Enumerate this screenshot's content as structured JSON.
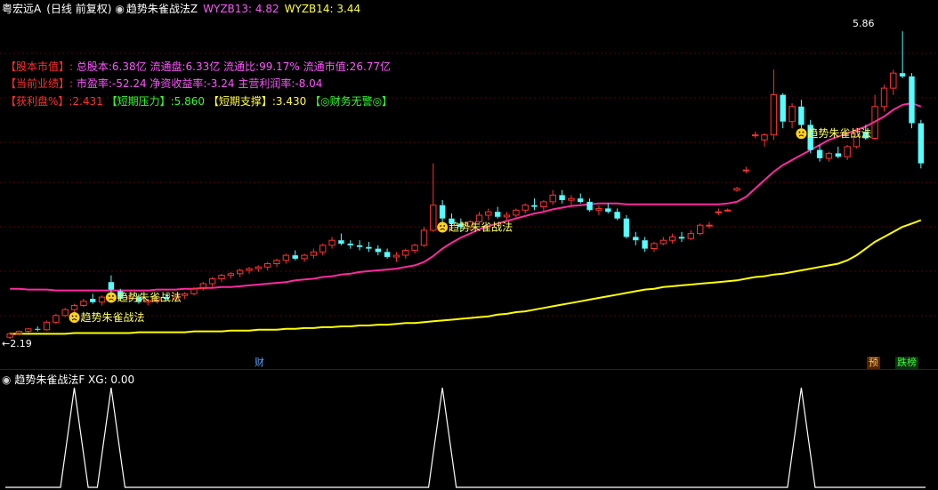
{
  "header": {
    "stock_name": "粤宏远A",
    "period": "(日线 前复权)",
    "indicator_name": "趋势朱雀战法Z",
    "ind1_label": "WYZB13: 4.82",
    "ind2_label": "WYZB14: 3.44"
  },
  "info": {
    "line1_tag": "【股本市值】:",
    "line1_text": "总股本:6.38亿 流通盘:6.33亿 流通比:99.17% 流通市值:26.77亿",
    "line2_tag": "【当前业绩】:",
    "line2_text": "市盈率:-52.24 净资收益率:-3.24 主营利润率:-8.04",
    "line3_a": "【获利盘%】:2.431",
    "line3_b": "【短期压力】:5.860",
    "line3_c": "【短期支撑】:3.430",
    "line3_d": "【◎财务无警◎】"
  },
  "annotations": {
    "signal_label": "趋势朱雀战法",
    "high_label": "5.86",
    "low_label": "2.19",
    "cai_badge": "财",
    "yu_badge": "预",
    "diebang_badge": "跌榜"
  },
  "sub_panel": {
    "title": "趋势朱雀战法F",
    "xg_label": "XG: 0.00"
  },
  "colors": {
    "up": "#ff3232",
    "down": "#54ffff",
    "ma_pink": "#ff2aa0",
    "ma_yellow": "#ffff00",
    "signal_text": "#ffff66"
  },
  "chart_data": {
    "type": "candlestick",
    "title": "粤宏远A (日线 前复权)",
    "ylim": [
      2.0,
      6.0
    ],
    "ohlc": [
      [
        2.2,
        2.26,
        2.18,
        2.24
      ],
      [
        2.24,
        2.28,
        2.22,
        2.27
      ],
      [
        2.27,
        2.31,
        2.25,
        2.3
      ],
      [
        2.3,
        2.33,
        2.27,
        2.29
      ],
      [
        2.29,
        2.4,
        2.28,
        2.38
      ],
      [
        2.38,
        2.48,
        2.36,
        2.46
      ],
      [
        2.46,
        2.55,
        2.44,
        2.53
      ],
      [
        2.53,
        2.6,
        2.5,
        2.58
      ],
      [
        2.58,
        2.66,
        2.56,
        2.63
      ],
      [
        2.66,
        2.72,
        2.6,
        2.62
      ],
      [
        2.62,
        2.7,
        2.58,
        2.68
      ],
      [
        2.86,
        2.94,
        2.74,
        2.77
      ],
      [
        2.75,
        2.78,
        2.65,
        2.66
      ],
      [
        2.66,
        2.7,
        2.62,
        2.68
      ],
      [
        2.68,
        2.72,
        2.6,
        2.62
      ],
      [
        2.62,
        2.66,
        2.58,
        2.64
      ],
      [
        2.64,
        2.7,
        2.6,
        2.68
      ],
      [
        2.68,
        2.72,
        2.64,
        2.66
      ],
      [
        2.66,
        2.72,
        2.62,
        2.7
      ],
      [
        2.7,
        2.74,
        2.66,
        2.72
      ],
      [
        2.72,
        2.8,
        2.7,
        2.78
      ],
      [
        2.78,
        2.86,
        2.76,
        2.84
      ],
      [
        2.84,
        2.92,
        2.8,
        2.9
      ],
      [
        2.9,
        2.96,
        2.86,
        2.94
      ],
      [
        2.94,
        2.98,
        2.9,
        2.96
      ],
      [
        2.96,
        3.02,
        2.92,
        3.0
      ],
      [
        3.0,
        3.04,
        2.96,
        3.02
      ],
      [
        3.02,
        3.06,
        2.98,
        3.04
      ],
      [
        3.04,
        3.1,
        3.0,
        3.08
      ],
      [
        3.08,
        3.14,
        3.04,
        3.12
      ],
      [
        3.12,
        3.2,
        3.08,
        3.18
      ],
      [
        3.18,
        3.24,
        3.12,
        3.14
      ],
      [
        3.14,
        3.2,
        3.1,
        3.18
      ],
      [
        3.18,
        3.26,
        3.14,
        3.22
      ],
      [
        3.22,
        3.32,
        3.18,
        3.3
      ],
      [
        3.3,
        3.4,
        3.26,
        3.36
      ],
      [
        3.36,
        3.44,
        3.3,
        3.32
      ],
      [
        3.32,
        3.36,
        3.26,
        3.3
      ],
      [
        3.3,
        3.36,
        3.24,
        3.28
      ],
      [
        3.28,
        3.34,
        3.22,
        3.26
      ],
      [
        3.26,
        3.3,
        3.18,
        3.22
      ],
      [
        3.22,
        3.26,
        3.14,
        3.16
      ],
      [
        3.16,
        3.22,
        3.1,
        3.18
      ],
      [
        3.18,
        3.26,
        3.14,
        3.24
      ],
      [
        3.24,
        3.32,
        3.2,
        3.3
      ],
      [
        3.3,
        3.52,
        3.28,
        3.48
      ],
      [
        3.48,
        4.28,
        3.46,
        3.78
      ],
      [
        3.78,
        3.84,
        3.58,
        3.62
      ],
      [
        3.62,
        3.68,
        3.5,
        3.56
      ],
      [
        3.56,
        3.62,
        3.46,
        3.52
      ],
      [
        3.52,
        3.6,
        3.48,
        3.58
      ],
      [
        3.58,
        3.7,
        3.54,
        3.66
      ],
      [
        3.66,
        3.74,
        3.6,
        3.7
      ],
      [
        3.7,
        3.76,
        3.62,
        3.64
      ],
      [
        3.64,
        3.7,
        3.58,
        3.66
      ],
      [
        3.66,
        3.74,
        3.62,
        3.72
      ],
      [
        3.72,
        3.8,
        3.68,
        3.78
      ],
      [
        3.78,
        3.86,
        3.72,
        3.76
      ],
      [
        3.76,
        3.84,
        3.7,
        3.82
      ],
      [
        3.82,
        3.96,
        3.78,
        3.9
      ],
      [
        3.9,
        3.96,
        3.8,
        3.84
      ],
      [
        3.84,
        3.9,
        3.78,
        3.86
      ],
      [
        3.86,
        3.92,
        3.8,
        3.82
      ],
      [
        3.82,
        3.86,
        3.7,
        3.72
      ],
      [
        3.72,
        3.78,
        3.66,
        3.74
      ],
      [
        3.74,
        3.8,
        3.68,
        3.7
      ],
      [
        3.7,
        3.74,
        3.6,
        3.62
      ],
      [
        3.62,
        3.66,
        3.38,
        3.4
      ],
      [
        3.4,
        3.46,
        3.3,
        3.36
      ],
      [
        3.36,
        3.4,
        3.22,
        3.26
      ],
      [
        3.26,
        3.34,
        3.22,
        3.32
      ],
      [
        3.32,
        3.4,
        3.3,
        3.36
      ],
      [
        3.36,
        3.44,
        3.32,
        3.4
      ],
      [
        3.4,
        3.46,
        3.34,
        3.38
      ],
      [
        3.38,
        3.48,
        3.36,
        3.44
      ],
      [
        3.44,
        3.56,
        3.42,
        3.54
      ],
      [
        3.54,
        3.58,
        3.5,
        3.54
      ],
      [
        3.7,
        3.74,
        3.66,
        3.7
      ],
      [
        3.72,
        3.74,
        3.7,
        3.72
      ],
      [
        3.96,
        4.0,
        3.94,
        3.98
      ],
      [
        4.2,
        4.24,
        4.16,
        4.2
      ],
      [
        4.62,
        4.66,
        4.58,
        4.62
      ],
      [
        4.56,
        4.64,
        4.48,
        4.62
      ],
      [
        4.62,
        5.4,
        4.56,
        5.1
      ],
      [
        5.1,
        5.12,
        4.7,
        4.78
      ],
      [
        4.78,
        5.0,
        4.7,
        4.96
      ],
      [
        4.96,
        5.04,
        4.7,
        4.74
      ],
      [
        4.74,
        4.8,
        4.4,
        4.44
      ],
      [
        4.44,
        4.5,
        4.3,
        4.34
      ],
      [
        4.34,
        4.42,
        4.3,
        4.4
      ],
      [
        4.4,
        4.48,
        4.34,
        4.36
      ],
      [
        4.36,
        4.5,
        4.32,
        4.48
      ],
      [
        4.48,
        4.7,
        4.46,
        4.66
      ],
      [
        4.66,
        4.74,
        4.56,
        4.58
      ],
      [
        4.58,
        5.1,
        4.56,
        4.96
      ],
      [
        4.96,
        5.22,
        4.9,
        5.18
      ],
      [
        5.18,
        5.4,
        5.1,
        5.36
      ],
      [
        5.36,
        5.86,
        5.3,
        5.32
      ],
      [
        5.32,
        5.36,
        4.7,
        4.76
      ],
      [
        4.76,
        4.8,
        4.22,
        4.28
      ]
    ],
    "ma_pink": [
      2.78,
      2.78,
      2.77,
      2.77,
      2.77,
      2.76,
      2.76,
      2.76,
      2.76,
      2.76,
      2.76,
      2.76,
      2.76,
      2.76,
      2.76,
      2.76,
      2.77,
      2.77,
      2.77,
      2.78,
      2.78,
      2.79,
      2.79,
      2.8,
      2.8,
      2.81,
      2.82,
      2.83,
      2.84,
      2.85,
      2.86,
      2.88,
      2.89,
      2.9,
      2.92,
      2.93,
      2.95,
      2.96,
      2.98,
      2.99,
      3.0,
      3.01,
      3.02,
      3.04,
      3.06,
      3.1,
      3.17,
      3.26,
      3.33,
      3.39,
      3.44,
      3.49,
      3.53,
      3.56,
      3.59,
      3.62,
      3.65,
      3.68,
      3.7,
      3.73,
      3.75,
      3.77,
      3.78,
      3.79,
      3.8,
      3.8,
      3.8,
      3.79,
      3.79,
      3.79,
      3.79,
      3.79,
      3.79,
      3.79,
      3.79,
      3.79,
      3.79,
      3.79,
      3.8,
      3.82,
      3.88,
      3.98,
      4.08,
      4.18,
      4.26,
      4.32,
      4.38,
      4.44,
      4.5,
      4.56,
      4.6,
      4.64,
      4.68,
      4.72,
      4.78,
      4.84,
      4.92,
      4.98,
      5.0,
      4.96
    ],
    "ma_yellow": [
      2.24,
      2.24,
      2.24,
      2.24,
      2.24,
      2.24,
      2.24,
      2.25,
      2.25,
      2.25,
      2.25,
      2.25,
      2.25,
      2.25,
      2.26,
      2.26,
      2.26,
      2.26,
      2.26,
      2.26,
      2.27,
      2.27,
      2.27,
      2.27,
      2.28,
      2.28,
      2.28,
      2.29,
      2.29,
      2.29,
      2.3,
      2.3,
      2.31,
      2.31,
      2.32,
      2.32,
      2.33,
      2.33,
      2.34,
      2.34,
      2.35,
      2.35,
      2.36,
      2.37,
      2.37,
      2.38,
      2.39,
      2.4,
      2.41,
      2.42,
      2.43,
      2.44,
      2.45,
      2.47,
      2.48,
      2.5,
      2.51,
      2.53,
      2.55,
      2.57,
      2.59,
      2.61,
      2.63,
      2.65,
      2.67,
      2.69,
      2.71,
      2.73,
      2.75,
      2.77,
      2.78,
      2.8,
      2.81,
      2.82,
      2.83,
      2.84,
      2.85,
      2.86,
      2.87,
      2.88,
      2.9,
      2.92,
      2.93,
      2.95,
      2.96,
      2.98,
      3.0,
      3.02,
      3.04,
      3.06,
      3.08,
      3.12,
      3.18,
      3.26,
      3.34,
      3.4,
      3.46,
      3.52,
      3.56,
      3.6
    ],
    "signal_indices": [
      7,
      11,
      47,
      86
    ],
    "sub_series": {
      "name": "XG",
      "spikes": [
        7,
        11,
        47,
        86
      ],
      "ylim": [
        0,
        1
      ]
    },
    "legend_placement": "top-left",
    "grid": true
  }
}
